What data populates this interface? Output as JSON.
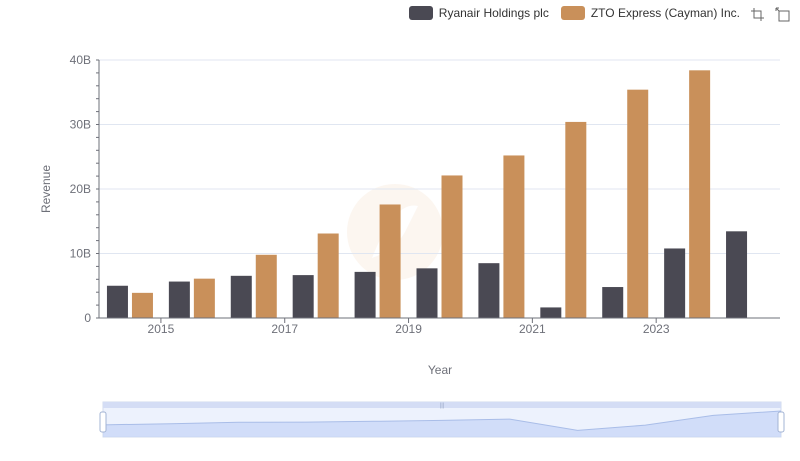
{
  "legend": {
    "items": [
      {
        "label": "Ryanair Holdings plc",
        "color": "#4a4953"
      },
      {
        "label": "ZTO Express (Cayman) Inc.",
        "color": "#c9905a"
      }
    ]
  },
  "toolbox": {
    "icons": [
      "zoom-icon",
      "zoom-reset-icon"
    ]
  },
  "chart_data": {
    "type": "bar",
    "title": "",
    "xlabel": "Year",
    "ylabel": "Revenue",
    "x": [
      2014,
      2015,
      2016,
      2017,
      2018,
      2019,
      2020,
      2021,
      2022,
      2023,
      2024
    ],
    "x_tick_labels": [
      "2015",
      "2017",
      "2019",
      "2021",
      "2023"
    ],
    "y_tick_labels": [
      "0",
      "10B",
      "20B",
      "30B",
      "40B"
    ],
    "ylim": [
      0,
      40000000000
    ],
    "grid": true,
    "legend_position": "top-right",
    "series": [
      {
        "name": "Ryanair Holdings plc",
        "color": "#4a4953",
        "values": [
          5000000000,
          5650000000,
          6540000000,
          6650000000,
          7150000000,
          7700000000,
          8500000000,
          1640000000,
          4800000000,
          10780000000,
          13440000000
        ]
      },
      {
        "name": "ZTO Express (Cayman) Inc.",
        "color": "#c9905a",
        "values": [
          3900000000,
          6100000000,
          9800000000,
          13100000000,
          17600000000,
          22100000000,
          25200000000,
          30400000000,
          35400000000,
          38400000000,
          null
        ]
      }
    ]
  },
  "data_zoom": {
    "range_percent": [
      0,
      100
    ]
  }
}
